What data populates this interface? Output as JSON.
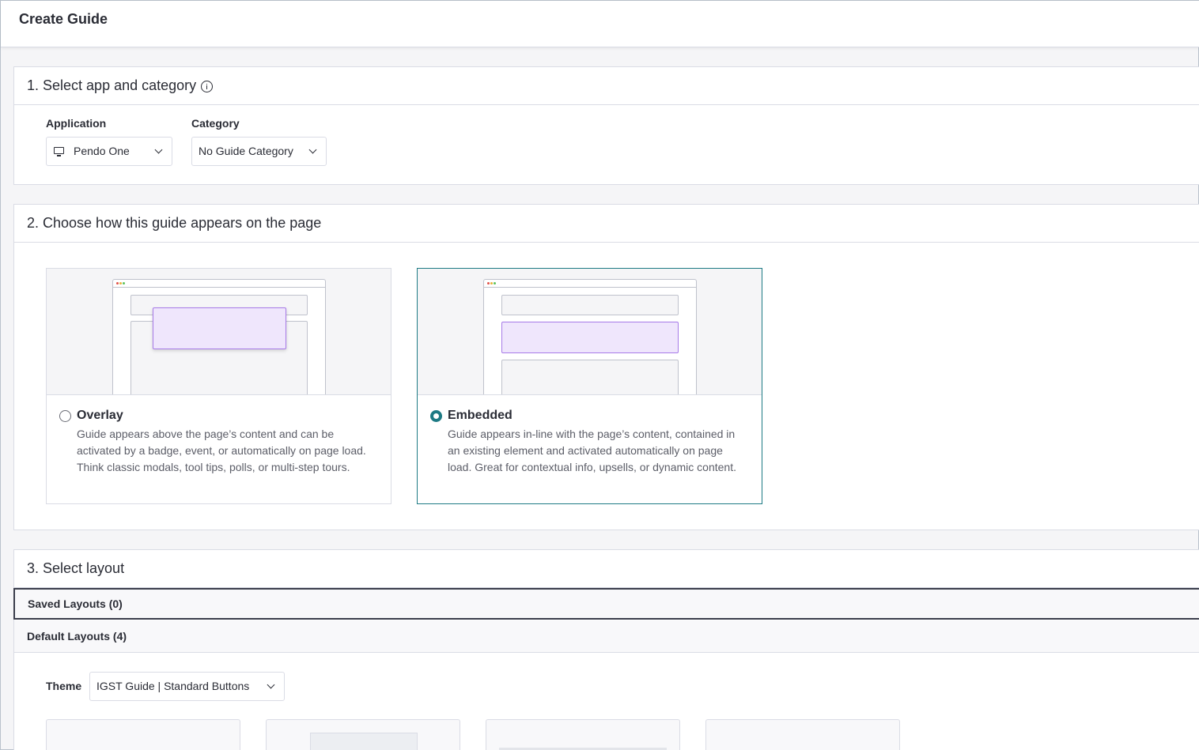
{
  "page": {
    "title": "Create Guide"
  },
  "section1": {
    "title": "1. Select app and category",
    "application": {
      "label": "Application",
      "value": "Pendo One",
      "icon": "monitor-icon"
    },
    "category": {
      "label": "Category",
      "value": "No Guide Category"
    }
  },
  "section2": {
    "title": "2. Choose how this guide appears on the page",
    "options": [
      {
        "title": "Overlay",
        "description": "Guide appears above the page’s content and can be activated by a badge, event, or automatically on page load. Think classic modals, tool tips, polls, or multi-step tours.",
        "selected": false
      },
      {
        "title": "Embedded",
        "description": "Guide appears in-line with the page’s content, contained in an existing element and activated automatically on page load. Great for contextual info, upsells, or dynamic content.",
        "selected": true
      }
    ]
  },
  "section3": {
    "title": "3. Select layout",
    "saved_layouts": "Saved Layouts (0)",
    "default_layouts": "Default Layouts (4)",
    "theme": {
      "label": "Theme",
      "value": "IGST Guide | Standard Buttons"
    }
  },
  "colors": {
    "accent": "#1d7a84",
    "preview_highlight": "#efe6fc",
    "preview_highlight_border": "#a77ae8"
  }
}
